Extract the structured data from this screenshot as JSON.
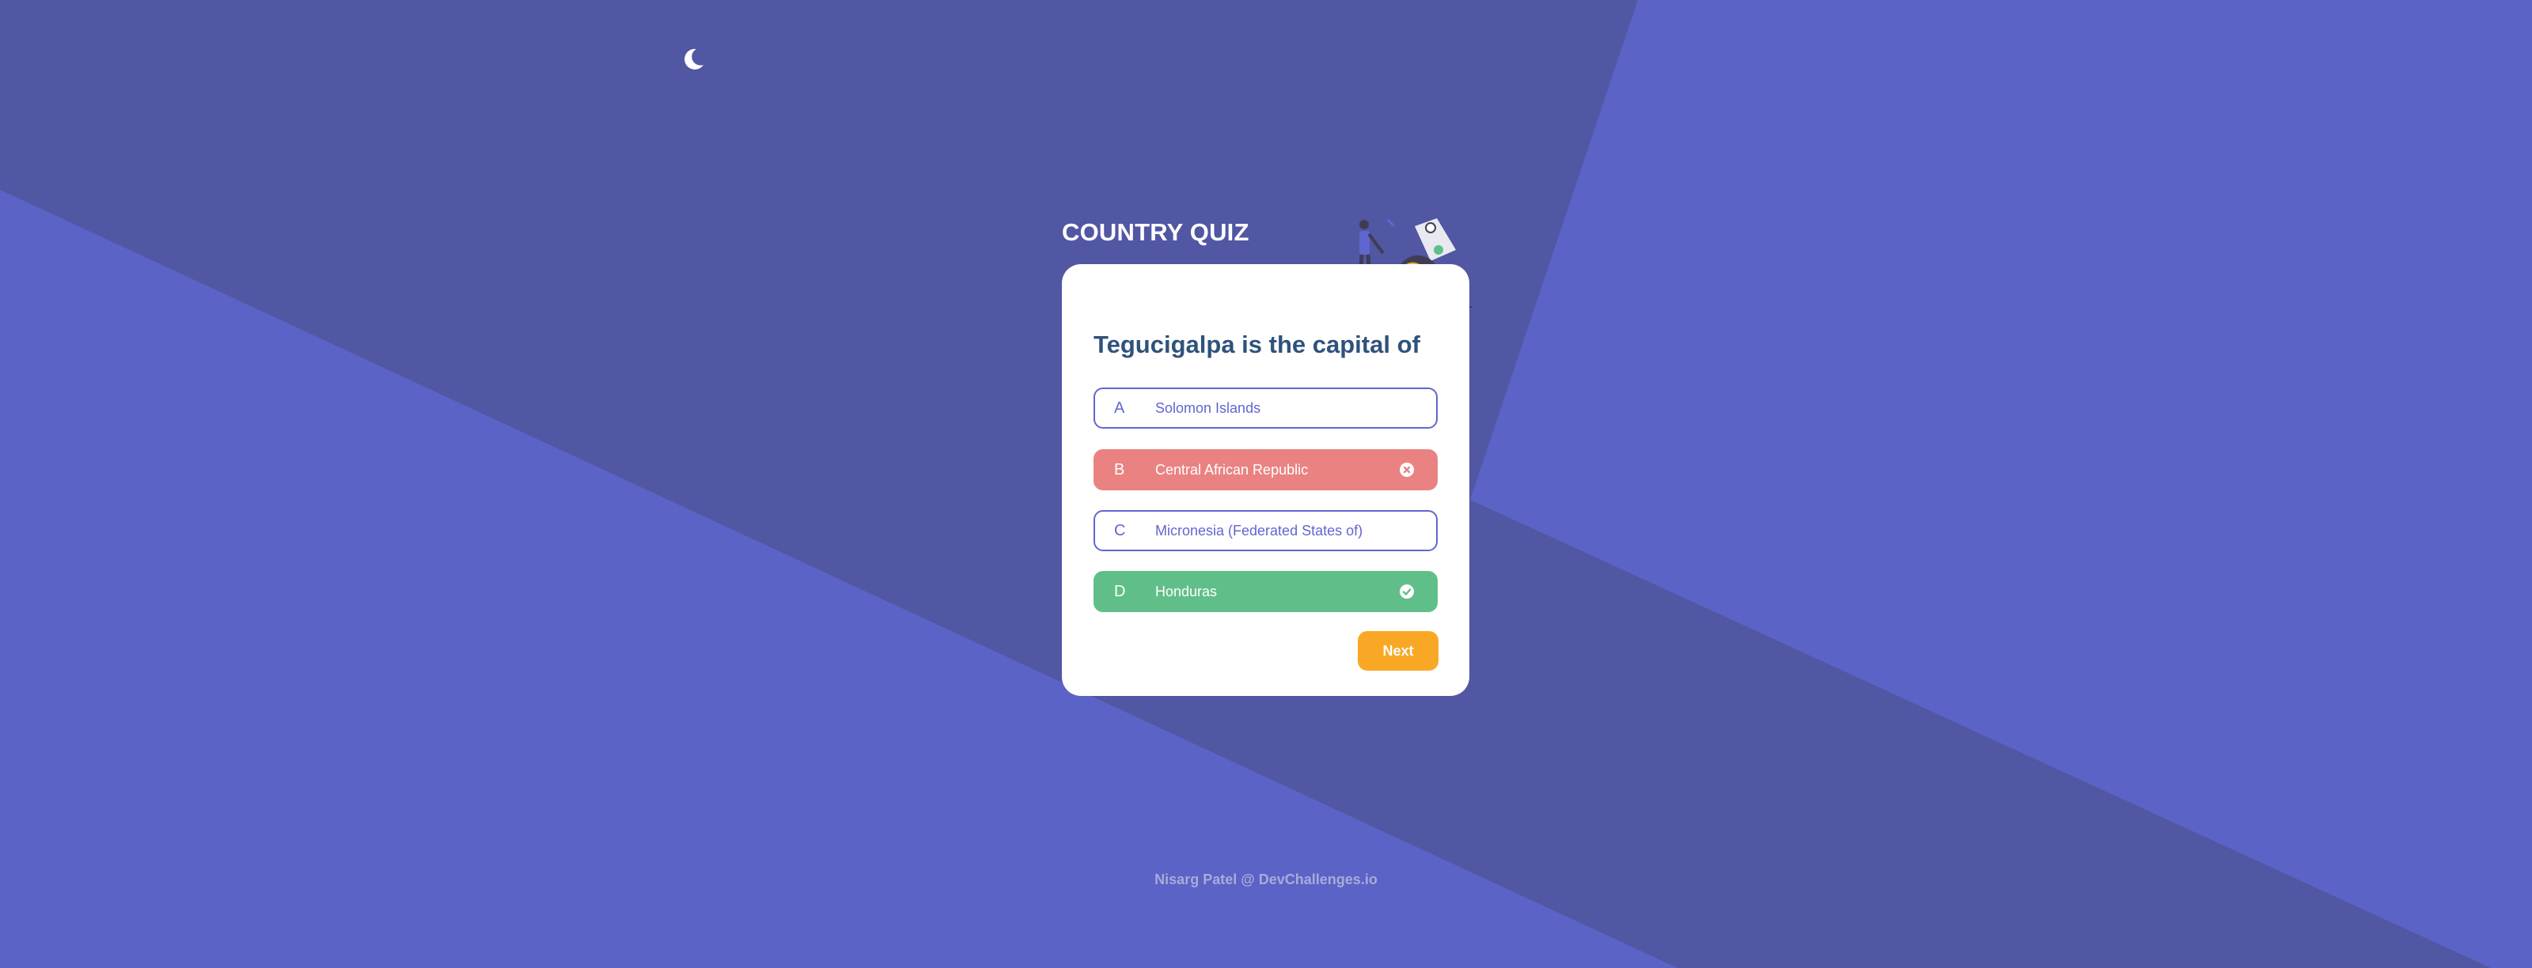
{
  "colors": {
    "background": "#5B63C6",
    "background_shade": "#5157A3",
    "card": "#FFFFFF",
    "accent": "#6066D0",
    "question_text": "#2F527B",
    "wrong": "#EA8282",
    "correct": "#60BF88",
    "next_button": "#F9A826"
  },
  "header": {
    "theme_toggle_icon": "moon-icon",
    "title": "COUNTRY QUIZ",
    "illustration": "person-with-globe-illustration"
  },
  "quiz": {
    "question": "Tegucigalpa is the capital of",
    "answers": [
      {
        "letter": "A",
        "text": "Solomon Islands",
        "state": "default",
        "icon": ""
      },
      {
        "letter": "B",
        "text": "Central African Republic",
        "state": "wrong",
        "icon": "x-circle-icon"
      },
      {
        "letter": "C",
        "text": "Micronesia (Federated States of)",
        "state": "default",
        "icon": ""
      },
      {
        "letter": "D",
        "text": "Honduras",
        "state": "correct",
        "icon": "check-circle-icon"
      }
    ],
    "next_label": "Next"
  },
  "footer": {
    "text": "Nisarg Patel @ DevChallenges.io"
  }
}
